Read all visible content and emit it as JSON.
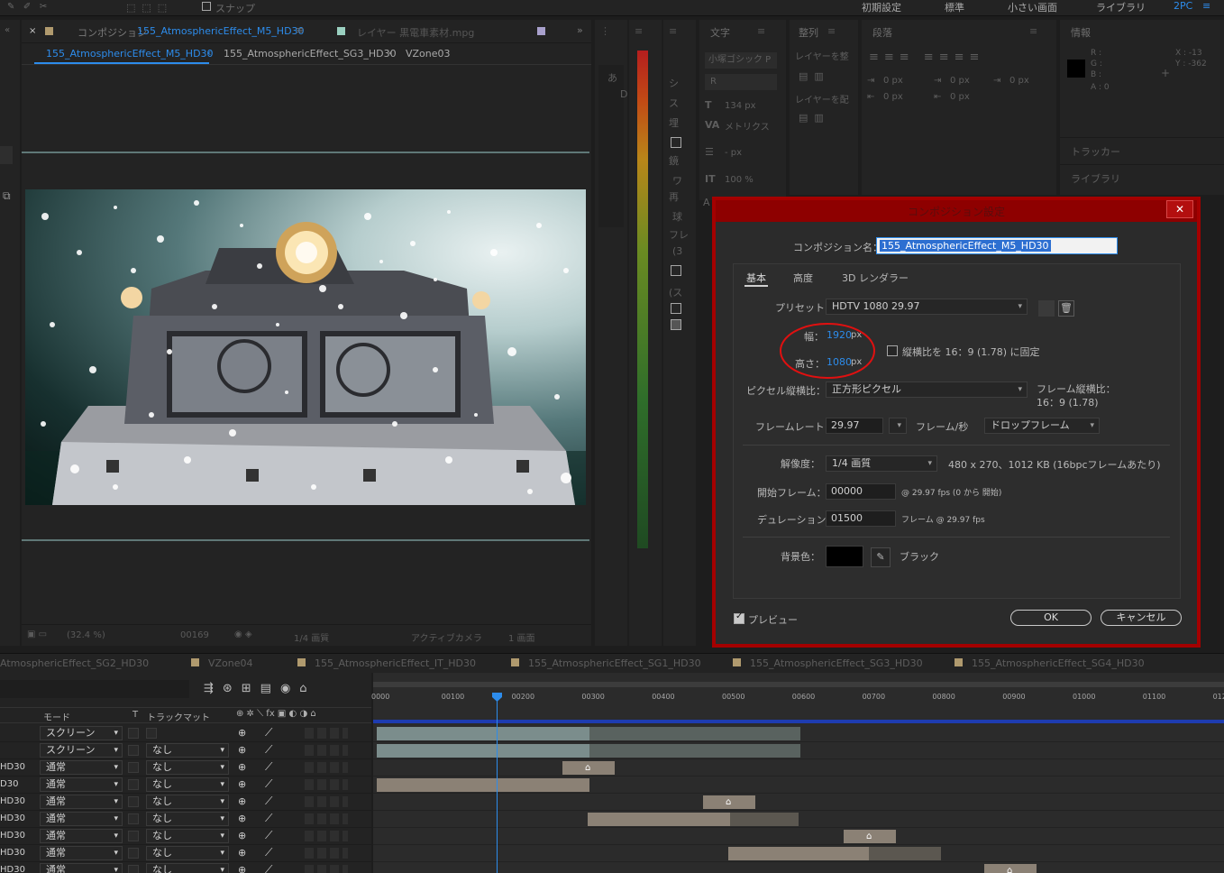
{
  "topbar": {
    "snap_label": "スナップ",
    "workspaces": [
      "初期設定",
      "標準",
      "小さい画面",
      "ライブラリ",
      "2PC"
    ]
  },
  "comp_panel": {
    "tab_prefix": "コンポジション",
    "tab_comp": "155_AtmosphericEffect_M5_HD30",
    "tab_layer": "レイヤー 黒電車素材.mpg",
    "breadcrumbs": [
      "155_AtmosphericEffect_M5_HD30",
      "155_AtmosphericEffect_SG3_HD30",
      "VZone03"
    ],
    "footer": {
      "zoom": "(32.4 %)",
      "timecode": "00169",
      "resolution": "1/4 画質",
      "camera": "アクティブカメラ",
      "views": "1 画面"
    }
  },
  "side_panels": {
    "left_col": [
      "あ",
      "D",
      "シ",
      "ス",
      "埋",
      "鏡",
      "ワ",
      "再",
      "球",
      "フレ",
      "(3",
      "(ス"
    ],
    "character": {
      "title": "文字",
      "font": "小塚ゴシック P",
      "style": "R",
      "size": "134 px",
      "kerning": "メトリクス",
      "leading": "- px",
      "vscale": "100 %",
      "letter": "A"
    },
    "align": {
      "title": "整列",
      "layer_to": "レイヤーを整",
      "layer_dist": "レイヤーを配"
    },
    "paragraph": {
      "title": "段落",
      "indent1": "0 px",
      "indent2": "0 px",
      "indent3": "0 px",
      "space1": "0 px",
      "space2": "0 px"
    },
    "info": {
      "title": "情報",
      "r": "R :",
      "g": "G :",
      "b": "B :",
      "a": "A : 0",
      "x": "X : -13",
      "y": "Y : -362",
      "tracker": "トラッカー",
      "library": "ライブラリ"
    }
  },
  "dialog": {
    "title": "コンポジション設定",
    "name_label": "コンポジション名：",
    "name_value": "155_AtmosphericEffect_M5_HD30",
    "tabs": [
      "基本",
      "高度",
      "3D レンダラー"
    ],
    "preset_label": "プリセット：",
    "preset_value": "HDTV 1080 29.97",
    "width_label": "幅：",
    "width_value": "1920",
    "height_label": "高さ：",
    "height_value": "1080",
    "px": "px",
    "lock_aspect": "縦横比を 16：9 (1.78) に固定",
    "pixel_aspect_label": "ピクセル縦横比：",
    "pixel_aspect_value": "正方形ピクセル",
    "frame_aspect_label": "フレーム縦横比：",
    "frame_aspect_value": "16：9 (1.78)",
    "framerate_label": "フレームレート：",
    "framerate_value": "29.97",
    "framerate_unit": "フレーム/秒",
    "drop_frame": "ドロップフレーム",
    "resolution_label": "解像度：",
    "resolution_value": "1/4 画質",
    "resolution_info": "480 x 270、1012 KB (16bpcフレームあたり)",
    "start_label": "開始フレーム：",
    "start_value": "00000",
    "start_info": "@ 29.97 fps (0 から 開始)",
    "duration_label": "デュレーション：",
    "duration_value": "01500",
    "duration_info": "フレーム @ 29.97 fps",
    "bg_label": "背景色：",
    "bg_name": "ブラック",
    "bg_color": "#000000",
    "preview": "プレビュー",
    "ok": "OK",
    "cancel": "キャンセル"
  },
  "timeline": {
    "tabs": [
      "AtmosphericEffect_SG2_HD30",
      "VZone04",
      "155_AtmosphericEffect_IT_HD30",
      "155_AtmosphericEffect_SG1_HD30",
      "155_AtmosphericEffect_SG3_HD30",
      "155_AtmosphericEffect_SG4_HD30"
    ],
    "headers": {
      "mode": "モード",
      "t": "T",
      "trackmatte": "トラックマット"
    },
    "ruler": [
      "0000",
      "00100",
      "00200",
      "00300",
      "00400",
      "00500",
      "00600",
      "00700",
      "00800",
      "00900",
      "01000",
      "01100",
      "012"
    ],
    "rows": [
      {
        "name": "",
        "mode": "スクリーン",
        "matte": ""
      },
      {
        "name": "",
        "mode": "スクリーン",
        "matte": "なし"
      },
      {
        "name": "HD30",
        "mode": "通常",
        "matte": "なし"
      },
      {
        "name": "D30",
        "mode": "通常",
        "matte": "なし"
      },
      {
        "name": "HD30",
        "mode": "通常",
        "matte": "なし"
      },
      {
        "name": "HD30",
        "mode": "通常",
        "matte": "なし"
      },
      {
        "name": "HD30",
        "mode": "通常",
        "matte": "なし"
      },
      {
        "name": "HD30",
        "mode": "通常",
        "matte": "なし"
      },
      {
        "name": "HD30",
        "mode": "通常",
        "matte": "なし"
      }
    ]
  }
}
